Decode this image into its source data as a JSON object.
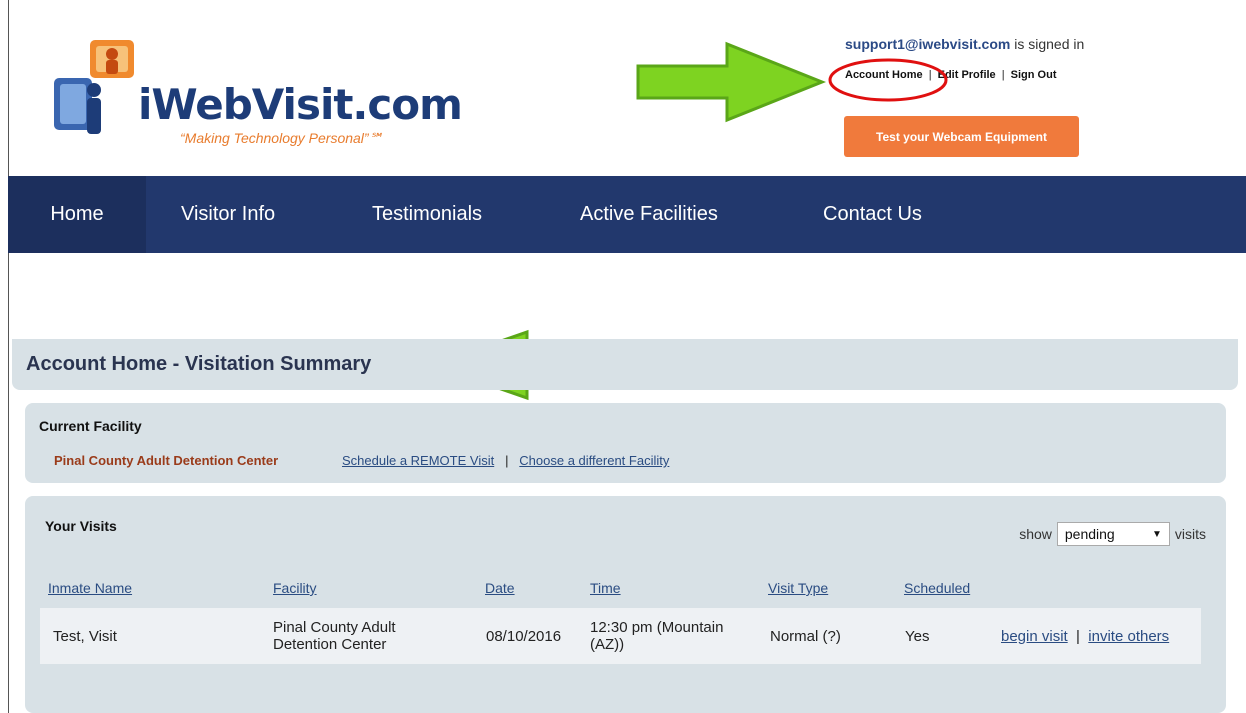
{
  "header": {
    "logo_text": "iWebVisit.com",
    "logo_tagline": "“Making Technology Personal”℠",
    "user_email": "support1@iwebvisit.com",
    "signed_in_text": "is signed in",
    "account_home": "Account Home",
    "edit_profile": "Edit Profile",
    "sign_out": "Sign Out",
    "separator": "|",
    "webcam_button": "Test your Webcam Equipment"
  },
  "nav": {
    "items": [
      {
        "label": "Home"
      },
      {
        "label": "Visitor Info"
      },
      {
        "label": "Testimonials"
      },
      {
        "label": "Active Facilities"
      },
      {
        "label": "Contact Us"
      }
    ]
  },
  "summary": {
    "title": "Account Home - Visitation Summary"
  },
  "current_facility": {
    "label": "Current Facility",
    "name": "Pinal County Adult Detention Center",
    "schedule_link": "Schedule a REMOTE Visit",
    "separator": "|",
    "choose_link": "Choose a different Facility"
  },
  "visits": {
    "label": "Your Visits",
    "show_prefix": "show",
    "show_value": "pending",
    "show_suffix": "visits",
    "columns": {
      "inmate": "Inmate Name",
      "facility": "Facility",
      "date": "Date",
      "time": "Time",
      "visit_type": "Visit Type",
      "scheduled": "Scheduled"
    },
    "rows": [
      {
        "inmate": "Test, Visit",
        "facility": "Pinal County Adult Detention Center",
        "date": "08/10/2016",
        "time": "12:30 pm (Mountain (AZ))",
        "visit_type": "Normal",
        "help": "(?)",
        "scheduled": "Yes",
        "begin": "begin visit",
        "separator": "|",
        "invite": "invite others"
      }
    ]
  },
  "colors": {
    "nav_bg": "#22386d",
    "accent_orange": "#f07a3c",
    "panel_bg": "#d8e1e6",
    "arrow_green": "#7ed321",
    "circle_red": "#e01010"
  }
}
